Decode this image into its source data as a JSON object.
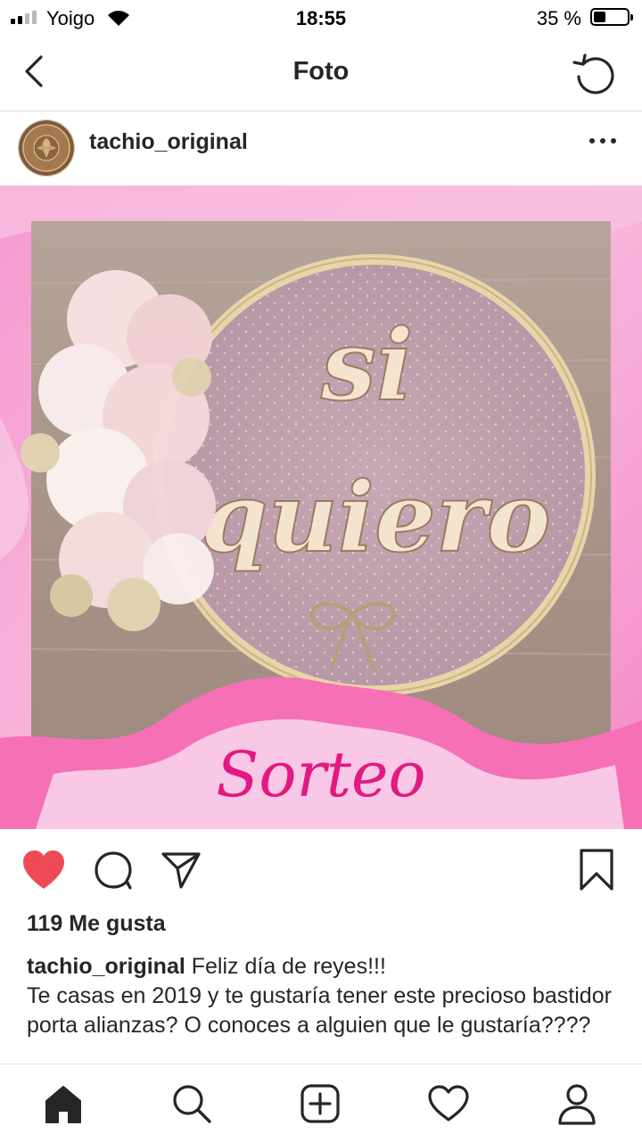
{
  "status_bar": {
    "carrier": "Yoigo",
    "time": "18:55",
    "battery_percent": "35 %",
    "battery_level": 0.35
  },
  "nav": {
    "title": "Foto"
  },
  "post": {
    "username": "tachio_original",
    "image": {
      "main_text_line1": "si",
      "main_text_line2": "quiero",
      "banner_text": "Sorteo",
      "colors": {
        "pink_background": "#f7a8d6",
        "banner_pink": "#f670b6",
        "sorteo_text": "#e31881",
        "hoop_wood": "#e9d7ae"
      }
    },
    "liked": true,
    "likes_text": "119 Me gusta",
    "caption_user": "tachio_original",
    "caption_text": " Feliz día de reyes!!!\nTe casas en 2019 y te gustaría tener este precioso bastidor porta alianzas? O conoces a alguien que le gustaría????",
    "like_color": "#ed4956"
  },
  "tab_bar": {
    "items": [
      "home-icon",
      "search-icon",
      "add-post-icon",
      "activity-heart-icon",
      "profile-icon"
    ],
    "active": "home-icon"
  }
}
